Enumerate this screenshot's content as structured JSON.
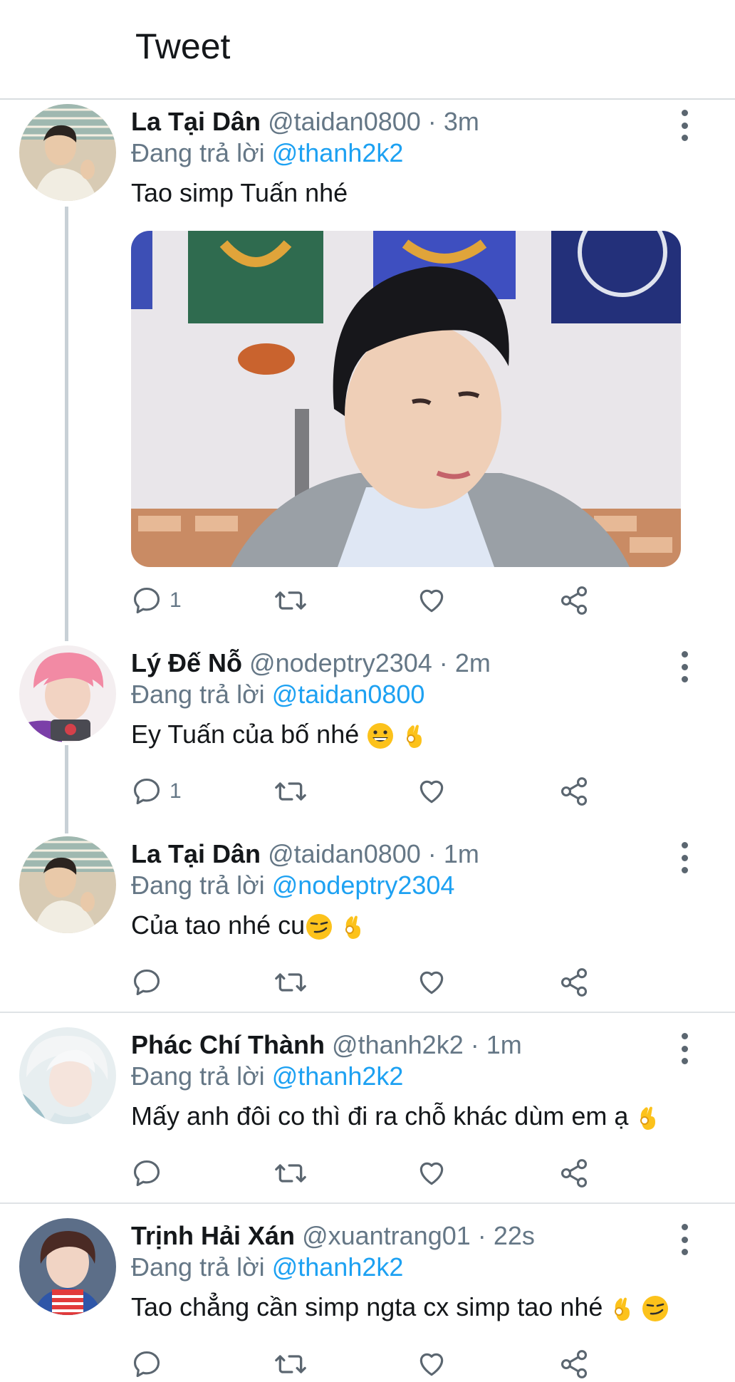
{
  "header": {
    "title": "Tweet"
  },
  "tweets": [
    {
      "name": "La Tại Dân",
      "handle": "@taidan0800",
      "time": "3m",
      "reply_prefix": "Đang trả lời",
      "reply_to": "@thanh2k2",
      "text": "Tao simp Tuấn nhé",
      "emojis": [],
      "reply_count": "1",
      "has_media": true
    },
    {
      "name": "Lý Đế Nỗ",
      "handle": "@nodeptry2304",
      "time": "2m",
      "reply_prefix": "Đang trả lời",
      "reply_to": "@taidan0800",
      "text": "Ey Tuấn của bố nhé",
      "emojis": [
        "grinning-face",
        "ok-hand"
      ],
      "reply_count": "1"
    },
    {
      "name": "La Tại Dân",
      "handle": "@taidan0800",
      "time": "1m",
      "reply_prefix": "Đang trả lời",
      "reply_to": "@nodeptry2304",
      "text": "Của tao nhé cu",
      "emojis": [
        "smirking-face",
        "ok-hand"
      ],
      "reply_count": ""
    },
    {
      "name": "Phác Chí Thành",
      "handle": "@thanh2k2",
      "time": "1m",
      "reply_prefix": "Đang trả lời",
      "reply_to": "@thanh2k2",
      "text": "Mấy anh đôi co thì đi ra chỗ khác dùm em ạ",
      "emojis": [
        "ok-hand"
      ],
      "reply_count": ""
    },
    {
      "name": "Trịnh Hải Xán",
      "handle": "@xuantrang01",
      "time": "22s",
      "reply_prefix": "Đang trả lời",
      "reply_to": "@thanh2k2",
      "text": "Tao chẳng cần simp ngta cx simp tao nhé",
      "emojis": [
        "ok-hand",
        "smirking-face"
      ],
      "reply_count": ""
    }
  ],
  "icons": {
    "reply": "speech-bubble-icon",
    "retweet": "retweet-icon",
    "like": "heart-icon",
    "share": "share-icon",
    "more": "more-vertical-icon"
  },
  "colors": {
    "link": "#1da1f2",
    "secondary": "#657786",
    "thread_line": "#c8d0d6"
  }
}
